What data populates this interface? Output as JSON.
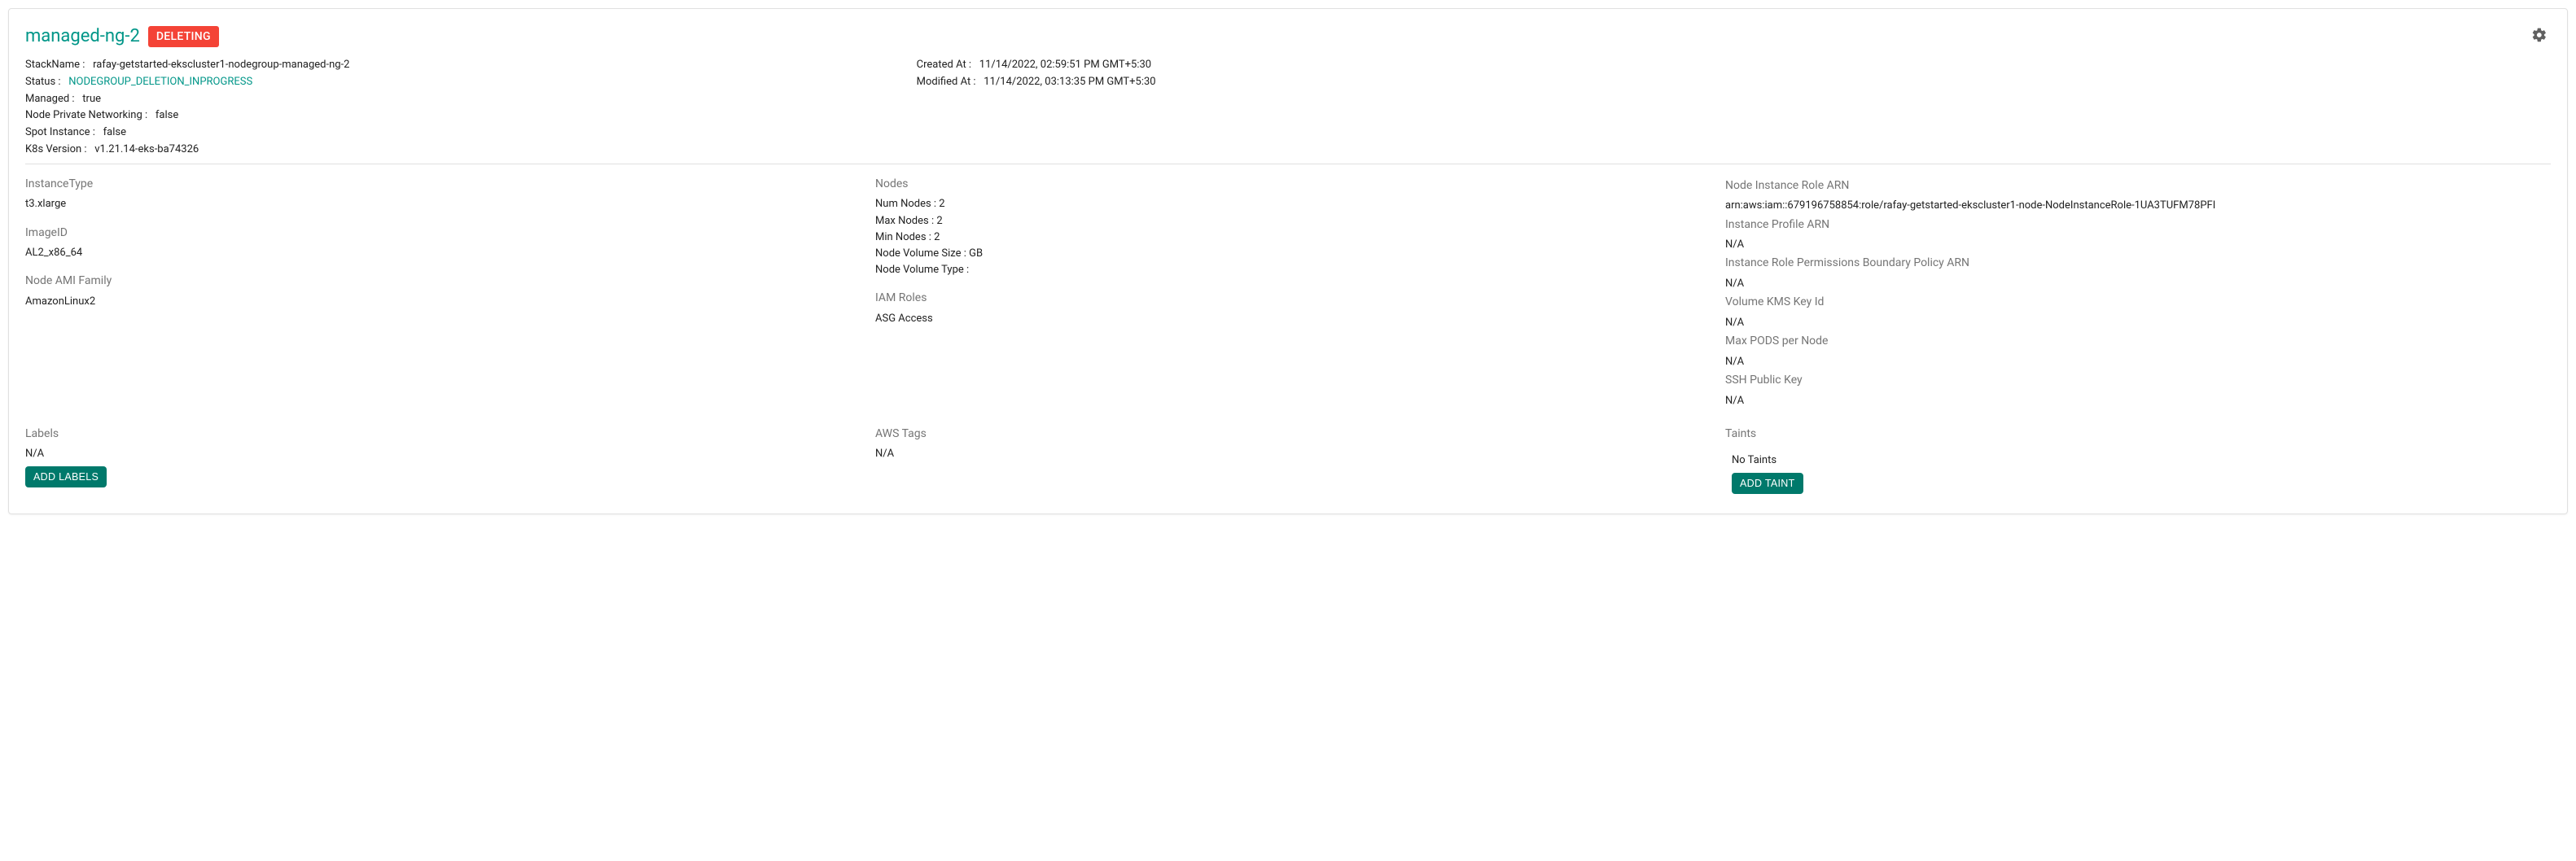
{
  "header": {
    "title": "managed-ng-2",
    "status_badge": "DELETING"
  },
  "meta_left": {
    "stack_name_label": "StackName :",
    "stack_name_value": "rafay-getstarted-ekscluster1-nodegroup-managed-ng-2",
    "status_label": "Status :",
    "status_value": "NODEGROUP_DELETION_INPROGRESS",
    "managed_label": "Managed :",
    "managed_value": "true",
    "node_priv_label": "Node Private Networking :",
    "node_priv_value": "false",
    "spot_label": "Spot Instance :",
    "spot_value": "false",
    "k8s_label": "K8s Version :",
    "k8s_value": "v1.21.14-eks-ba74326"
  },
  "meta_right": {
    "created_label": "Created At :",
    "created_value": "11/14/2022, 02:59:51 PM GMT+5:30",
    "modified_label": "Modified At :",
    "modified_value": "11/14/2022, 03:13:35 PM GMT+5:30"
  },
  "col1": {
    "instance_type_title": "InstanceType",
    "instance_type_value": "t3.xlarge",
    "image_id_title": "ImageID",
    "image_id_value": "AL2_x86_64",
    "node_ami_title": "Node AMI Family",
    "node_ami_value": "AmazonLinux2"
  },
  "col2": {
    "nodes_title": "Nodes",
    "num_nodes": "Num Nodes : 2",
    "max_nodes": "Max Nodes : 2",
    "min_nodes": "Min Nodes : 2",
    "vol_size": "Node Volume Size :   GB",
    "vol_type": "Node Volume Type :",
    "iam_title": "IAM Roles",
    "iam_value": "ASG Access"
  },
  "col3": {
    "node_role_title": "Node Instance Role ARN",
    "node_role_value": "arn:aws:iam::679196758854:role/rafay-getstarted-ekscluster1-node-NodeInstanceRole-1UA3TUFM78PFI",
    "instance_profile_title": "Instance Profile ARN",
    "instance_profile_value": "N/A",
    "perm_boundary_title": "Instance Role Permissions Boundary Policy ARN",
    "perm_boundary_value": "N/A",
    "kms_title": "Volume KMS Key Id",
    "kms_value": "N/A",
    "max_pods_title": "Max PODS per Node",
    "max_pods_value": "N/A",
    "ssh_title": "SSH Public Key",
    "ssh_value": "N/A"
  },
  "labels": {
    "title": "Labels",
    "value": "N/A",
    "button": "ADD LABELS"
  },
  "aws_tags": {
    "title": "AWS Tags",
    "value": "N/A"
  },
  "taints": {
    "title": "Taints",
    "value": "No Taints",
    "button": "ADD TAINT"
  }
}
